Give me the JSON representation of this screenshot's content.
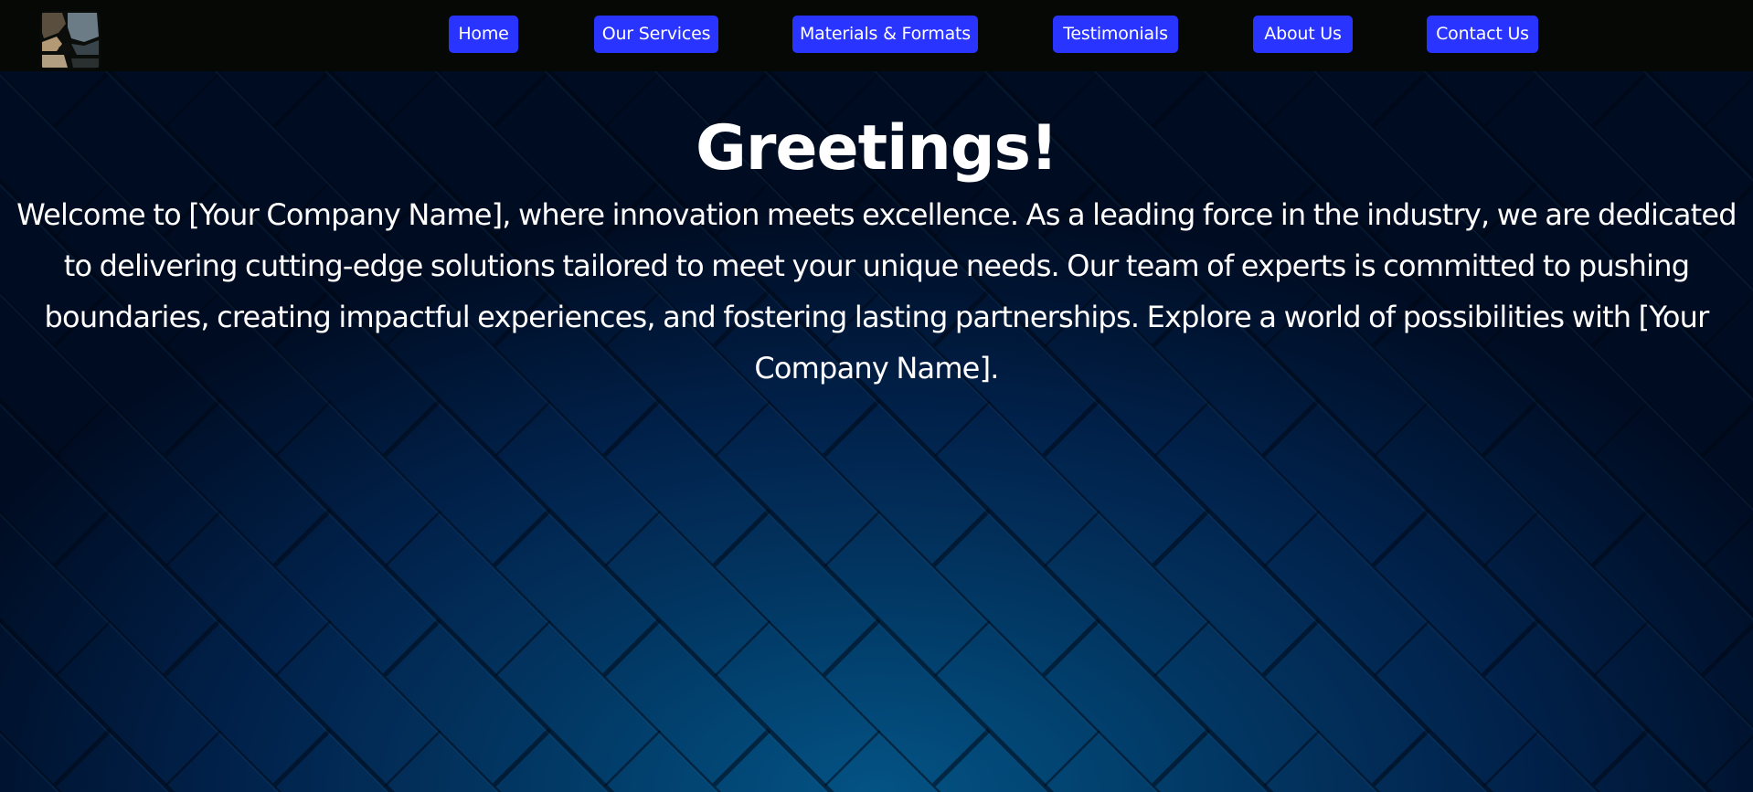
{
  "nav": {
    "logo_icon": "stone-mosaic-logo-icon",
    "items": [
      {
        "label": "Home"
      },
      {
        "label": "Our Services"
      },
      {
        "label": "Materials & Formats"
      },
      {
        "label": "Testimonials"
      },
      {
        "label": "About Us"
      },
      {
        "label": "Contact Us"
      }
    ]
  },
  "hero": {
    "title": "Greetings!",
    "text": "Welcome to [Your Company Name], where innovation meets excellence. As a leading force in the industry, we are dedicated to delivering cutting-edge solutions tailored to meet your unique needs. Our team of experts is committed to pushing boundaries, creating impactful experiences, and fostering lasting partnerships. Explore a world of possibilities with [Your Company Name]."
  },
  "colors": {
    "nav_background": "#050804",
    "nav_button": "#2a34ff",
    "hero_center": "#035384",
    "hero_edge": "#000c22",
    "text": "#ffffff"
  }
}
